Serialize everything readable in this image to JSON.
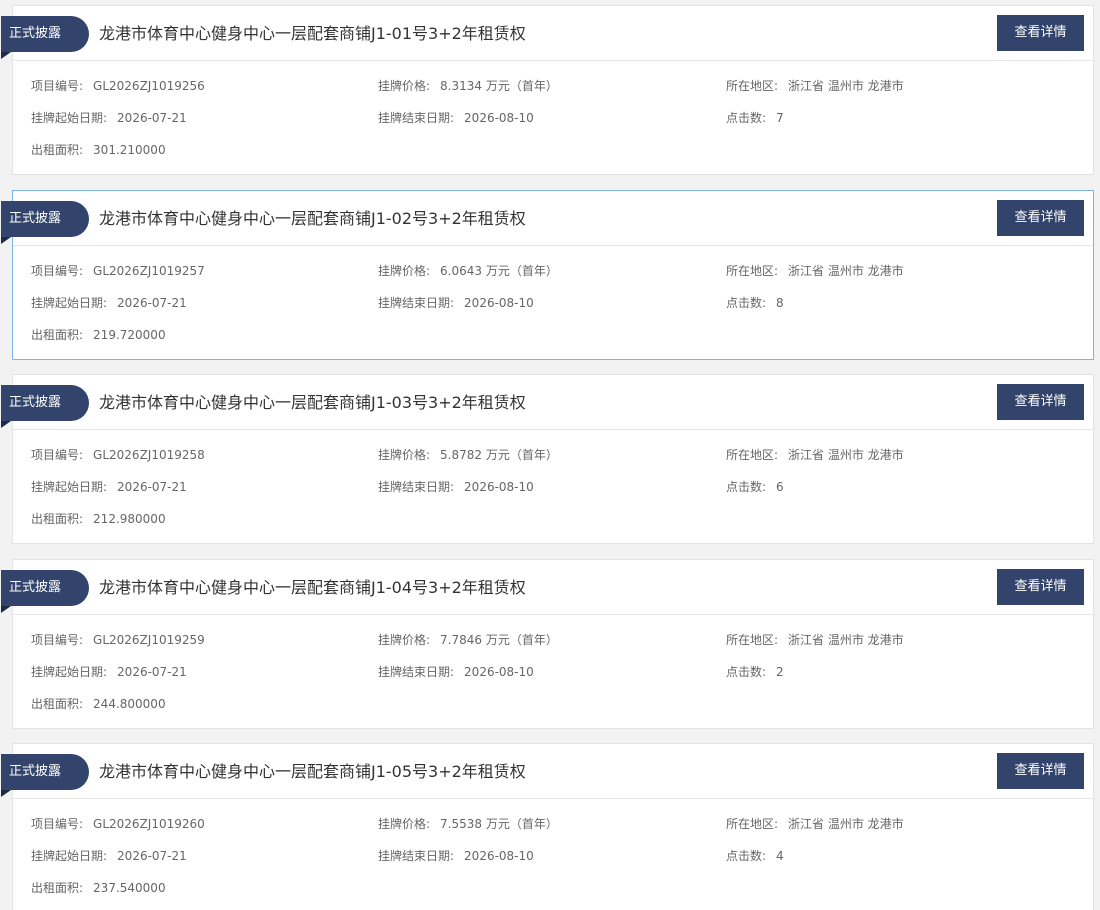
{
  "labels": {
    "badge": "正式披露",
    "detail_button": "查看详情",
    "project_no": "项目编号:",
    "price": "挂牌价格:",
    "region": "所在地区:",
    "start_date": "挂牌起始日期:",
    "end_date": "挂牌结束日期:",
    "clicks": "点击数:",
    "area": "出租面积:"
  },
  "items": [
    {
      "title": "龙港市体育中心健身中心一层配套商铺J1-01号3+2年租赁权",
      "project_no": "GL2026ZJ1019256",
      "price": "8.3134 万元（首年）",
      "region": "浙江省 温州市 龙港市",
      "start_date": "2026-07-21",
      "end_date": "2026-08-10",
      "clicks": "7",
      "area": "301.210000"
    },
    {
      "title": "龙港市体育中心健身中心一层配套商铺J1-02号3+2年租赁权",
      "project_no": "GL2026ZJ1019257",
      "price": "6.0643 万元（首年）",
      "region": "浙江省 温州市 龙港市",
      "start_date": "2026-07-21",
      "end_date": "2026-08-10",
      "clicks": "8",
      "area": "219.720000"
    },
    {
      "title": "龙港市体育中心健身中心一层配套商铺J1-03号3+2年租赁权",
      "project_no": "GL2026ZJ1019258",
      "price": "5.8782 万元（首年）",
      "region": "浙江省 温州市 龙港市",
      "start_date": "2026-07-21",
      "end_date": "2026-08-10",
      "clicks": "6",
      "area": "212.980000"
    },
    {
      "title": "龙港市体育中心健身中心一层配套商铺J1-04号3+2年租赁权",
      "project_no": "GL2026ZJ1019259",
      "price": "7.7846 万元（首年）",
      "region": "浙江省 温州市 龙港市",
      "start_date": "2026-07-21",
      "end_date": "2026-08-10",
      "clicks": "2",
      "area": "244.800000"
    },
    {
      "title": "龙港市体育中心健身中心一层配套商铺J1-05号3+2年租赁权",
      "project_no": "GL2026ZJ1019260",
      "price": "7.5538 万元（首年）",
      "region": "浙江省 温州市 龙港市",
      "start_date": "2026-07-21",
      "end_date": "2026-08-10",
      "clicks": "4",
      "area": "237.540000"
    }
  ],
  "colors": {
    "accent": "#32446b",
    "active_border": "#7fb1ea"
  }
}
